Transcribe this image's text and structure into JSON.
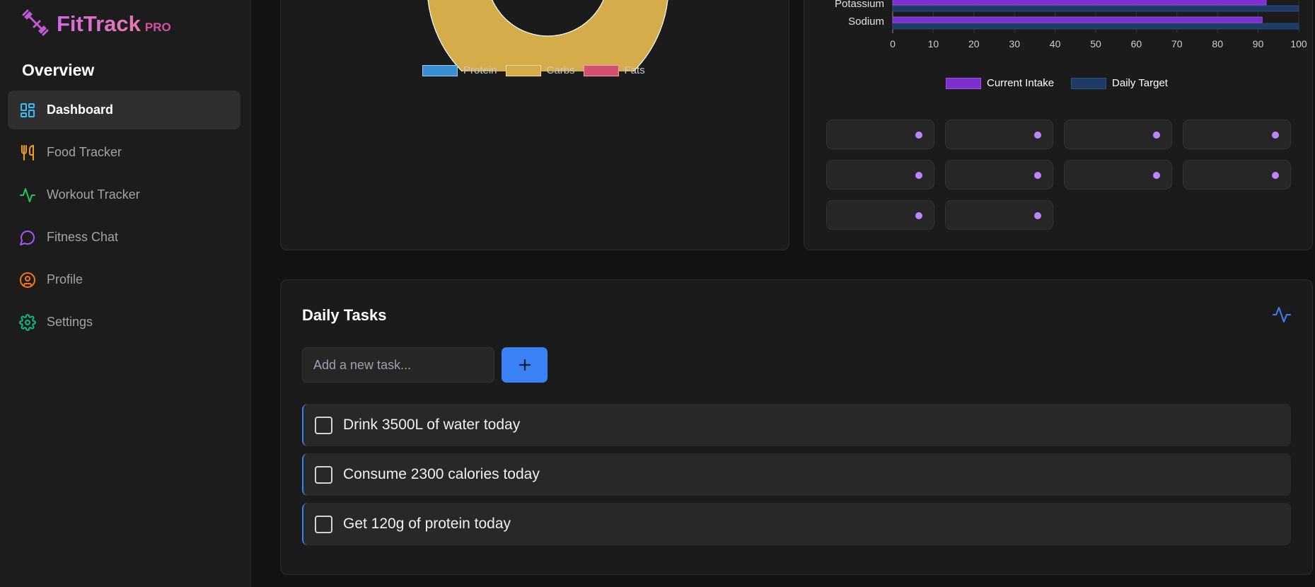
{
  "brand": {
    "name": "FitTrack",
    "badge": "PRO"
  },
  "sidebar": {
    "section_title": "Overview",
    "items": [
      {
        "label": "Dashboard",
        "icon": "dashboard-icon",
        "color": "#38bdf8",
        "active": true
      },
      {
        "label": "Food Tracker",
        "icon": "utensils-icon",
        "color": "#f59e0b"
      },
      {
        "label": "Workout Tracker",
        "icon": "activity-icon",
        "color": "#22c55e"
      },
      {
        "label": "Fitness Chat",
        "icon": "chat-icon",
        "color": "#a855f7"
      },
      {
        "label": "Profile",
        "icon": "user-circle-icon",
        "color": "#f97316"
      },
      {
        "label": "Settings",
        "icon": "gear-icon",
        "color": "#10b981"
      }
    ]
  },
  "macros": {
    "legend": [
      {
        "label": "Protein",
        "color": "#3a8fd4"
      },
      {
        "label": "Carbs",
        "color": "#d4ad4a"
      },
      {
        "label": "Fats",
        "color": "#d4506e"
      }
    ]
  },
  "chart_data": {
    "type": "bar",
    "orientation": "horizontal",
    "categories": [
      "Potassium",
      "Sodium"
    ],
    "series": [
      {
        "name": "Current Intake",
        "values": [
          92,
          91
        ],
        "color": "#7e2fd0"
      },
      {
        "name": "Daily Target",
        "values": [
          100,
          100
        ],
        "color": "#1e3a66"
      }
    ],
    "x_ticks": [
      "0",
      "10",
      "20",
      "30",
      "40",
      "50",
      "60",
      "70",
      "80",
      "90",
      "100"
    ],
    "xlim": [
      0,
      100
    ],
    "grid": true,
    "legend_position": "bottom"
  },
  "nutrient_pills": {
    "count": 10,
    "dot_color": "#c084fc"
  },
  "tasks": {
    "title": "Daily Tasks",
    "input_placeholder": "Add a new task...",
    "add_label": "+",
    "items": [
      {
        "text": "Drink 3500L of water today",
        "done": false
      },
      {
        "text": "Consume 2300 calories today",
        "done": false
      },
      {
        "text": "Get 120g of protein today",
        "done": false
      }
    ]
  }
}
